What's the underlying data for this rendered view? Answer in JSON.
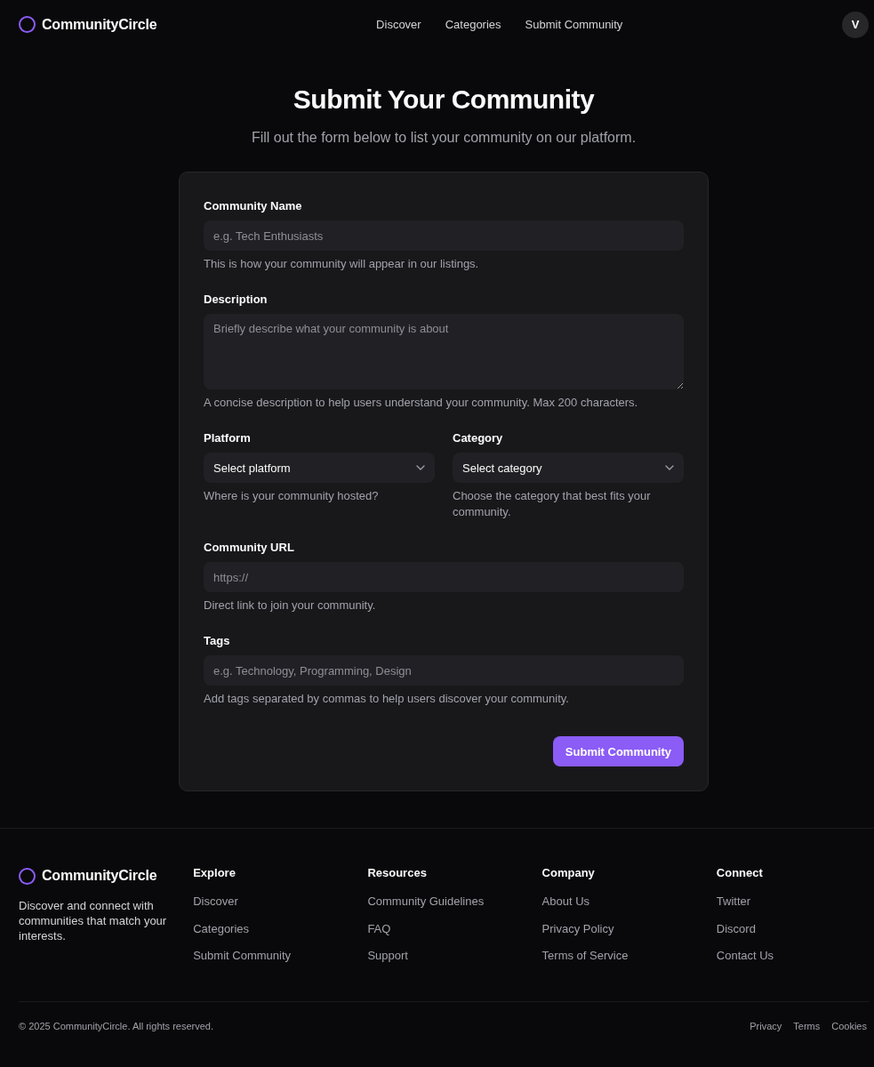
{
  "header": {
    "brand": "CommunityCircle",
    "nav": [
      "Discover",
      "Categories",
      "Submit Community"
    ],
    "avatar": "V"
  },
  "page": {
    "title": "Submit Your Community",
    "subtitle": "Fill out the form below to list your community on our platform."
  },
  "form": {
    "rows": [
      {
        "fields": [
          {
            "kind": "text",
            "label": "Community Name",
            "placeholder": "e.g. Tech Enthusiasts",
            "help": "This is how your community will appear in our listings."
          }
        ]
      },
      {
        "fields": [
          {
            "kind": "textarea",
            "label": "Description",
            "placeholder": "Briefly describe what your community is about",
            "help": "A concise description to help users understand your community. Max 200 characters."
          }
        ]
      },
      {
        "fields": [
          {
            "kind": "select",
            "label": "Platform",
            "placeholder": "Select platform",
            "help": "Where is your community hosted?"
          },
          {
            "kind": "select",
            "label": "Category",
            "placeholder": "Select category",
            "help": "Choose the category that best fits your community."
          }
        ]
      },
      {
        "fields": [
          {
            "kind": "text",
            "label": "Community URL",
            "placeholder": "https://",
            "help": "Direct link to join your community."
          }
        ]
      },
      {
        "fields": [
          {
            "kind": "text",
            "label": "Tags",
            "placeholder": "e.g. Technology, Programming, Design",
            "help": "Add tags separated by commas to help users discover your community."
          }
        ]
      }
    ],
    "submit": "Submit Community"
  },
  "footer": {
    "brand": "CommunityCircle",
    "tagline": "Discover and connect with communities that match your interests.",
    "columns": [
      {
        "heading": "Explore",
        "links": [
          "Discover",
          "Categories",
          "Submit Community"
        ]
      },
      {
        "heading": "Resources",
        "links": [
          "Community Guidelines",
          "FAQ",
          "Support"
        ]
      },
      {
        "heading": "Company",
        "links": [
          "About Us",
          "Privacy Policy",
          "Terms of Service"
        ]
      },
      {
        "heading": "Connect",
        "links": [
          "Twitter",
          "Discord",
          "Contact Us"
        ]
      }
    ],
    "copyright": "© 2025 CommunityCircle. All rights reserved.",
    "legal_links": [
      "Privacy",
      "Terms",
      "Cookies"
    ]
  }
}
